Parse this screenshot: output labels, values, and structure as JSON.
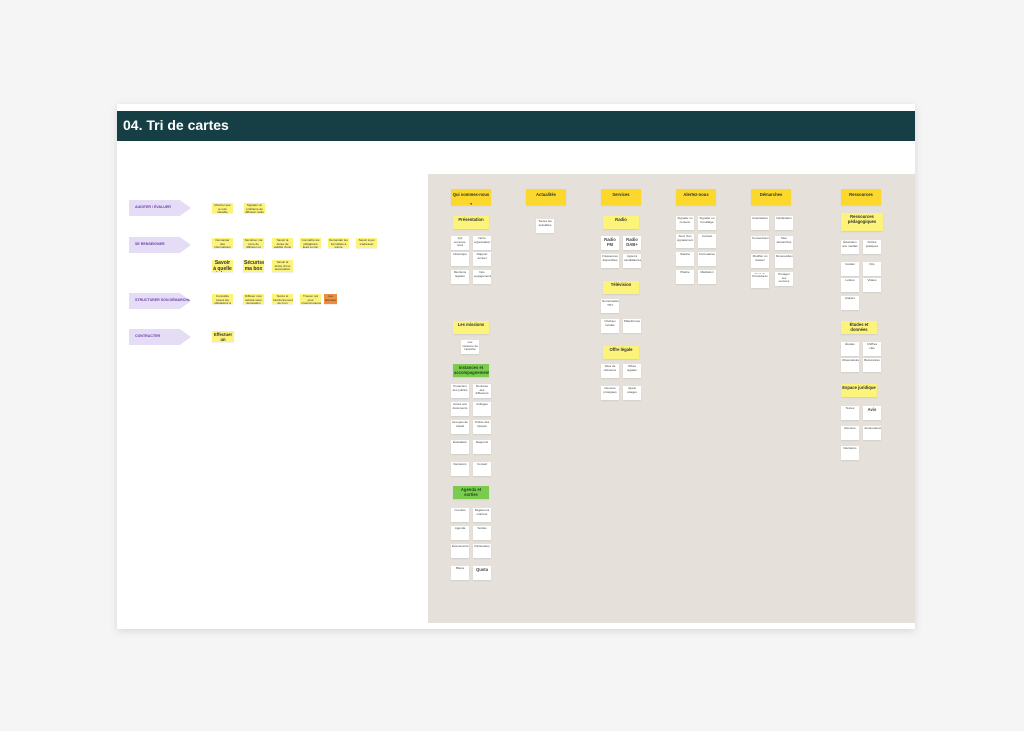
{
  "board": {
    "title": "04. Tri de cartes"
  },
  "flow": {
    "arrows": [
      "AUDITER / ÉVALUER",
      "SE RENSEIGNER",
      "STRUCTURER SON DÉMARCHE",
      "CONTRACTER"
    ],
    "notes": [
      "Montrer que je suis capable d'exploiter mon entreprise",
      "Signaler un problème de diffusion radio",
      "Demander des informations sur les aides possibles",
      "Sécuriser ma zone de diffusion et mes installations",
      "Savoir la durée de validité d'une autorisation",
      "Connaître les obligations liées à mon activité",
      "Demander les formalités à suivre",
      "Savoir à qui s'adresser",
      "Savoir à quelle réglementation répondre",
      "Savoir la durée d'une autorisation légale",
      "Sécuriser ma box",
      "Connaître toutes les obligations à respecter",
      "Diffuser mon activité sans dérogation",
      "Suivre le fonctionnement de mon dossier",
      "Trouver qui peut m'accompagner dans ma démarche",
      "Les données",
      "Effectuer un partenariat"
    ]
  },
  "columns": [
    {
      "name": "Qui sommes-nous ?",
      "groups": [
        "Présentation",
        "Les missions",
        "Instances et accompagnements",
        "Agenda et sorties"
      ],
      "cards": [
        "Qui sommes-nous",
        "Notre organisation",
        "Historique",
        "Rapport annuel",
        "Mentions légales",
        "Nos engagements",
        "Les missions de l'autorité",
        "Protection des publics",
        "Données des diffuseurs",
        "Accès aux documents",
        "Collèges",
        "Groupes de travail",
        "Ordres des travaux",
        "Évaluation",
        "Rapports",
        "Décisions",
        "Conseil",
        "Comités",
        "Règlement intérieur",
        "Agenda",
        "Sorties",
        "Événements",
        "Partenaires",
        "Bilans",
        "Quota"
      ]
    },
    {
      "name": "Actualités",
      "groups": [],
      "cards": [
        "Toutes les actualités"
      ]
    },
    {
      "name": "Services",
      "groups": [
        "Radio",
        "Télévision",
        "Offre légale"
      ],
      "cards": [
        "Radio FM",
        "Radio DAB+",
        "Fréquences disponibles",
        "Appel à candidatures",
        "Numérotation TNT",
        "Chaînes locales",
        "Plateformes",
        "Sites de référence",
        "Offres légales",
        "Oeuvres protégées",
        "Quels usages"
      ]
    },
    {
      "name": "Alertez-nous",
      "groups": [],
      "cards": [
        "Signaler un contenu",
        "Signaler un brouillage",
        "Suivi d'un signalement",
        "Contact",
        "Saisine",
        "Formulaires",
        "Plainte",
        "Médiation"
      ]
    },
    {
      "name": "Démarches",
      "groups": [],
      "cards": [
        "Autorisation",
        "Déclaration",
        "Conventionnement",
        "Mes démarches",
        "Modifier un dossier",
        "Renouvellement",
        "Suivi de dossier",
        "Procédures",
        "Protéger ses oeuvres"
      ]
    },
    {
      "name": "Ressources",
      "groups": [
        "Ressources pédagogiques",
        "Études et données",
        "Espace juridique"
      ],
      "cards": [
        "Éducation aux médias",
        "Fiches pratiques",
        "Guides",
        "Kits",
        "Lettres",
        "Vidéos",
        "Ateliers",
        "Études",
        "Chiffres clés",
        "Observatoire",
        "Baromètres",
        "Textes",
        "Avis",
        "Recours",
        "Jurisprudence",
        "Décisions"
      ]
    }
  ],
  "colors": {
    "header": "#163f45",
    "sortArea": "#e5e0da",
    "sticky": "#fbf37a",
    "category": "#fcd82c",
    "subgroup": "#7acb4e",
    "orange": "#ef8d3c",
    "arrow": "#e5dcf6"
  }
}
